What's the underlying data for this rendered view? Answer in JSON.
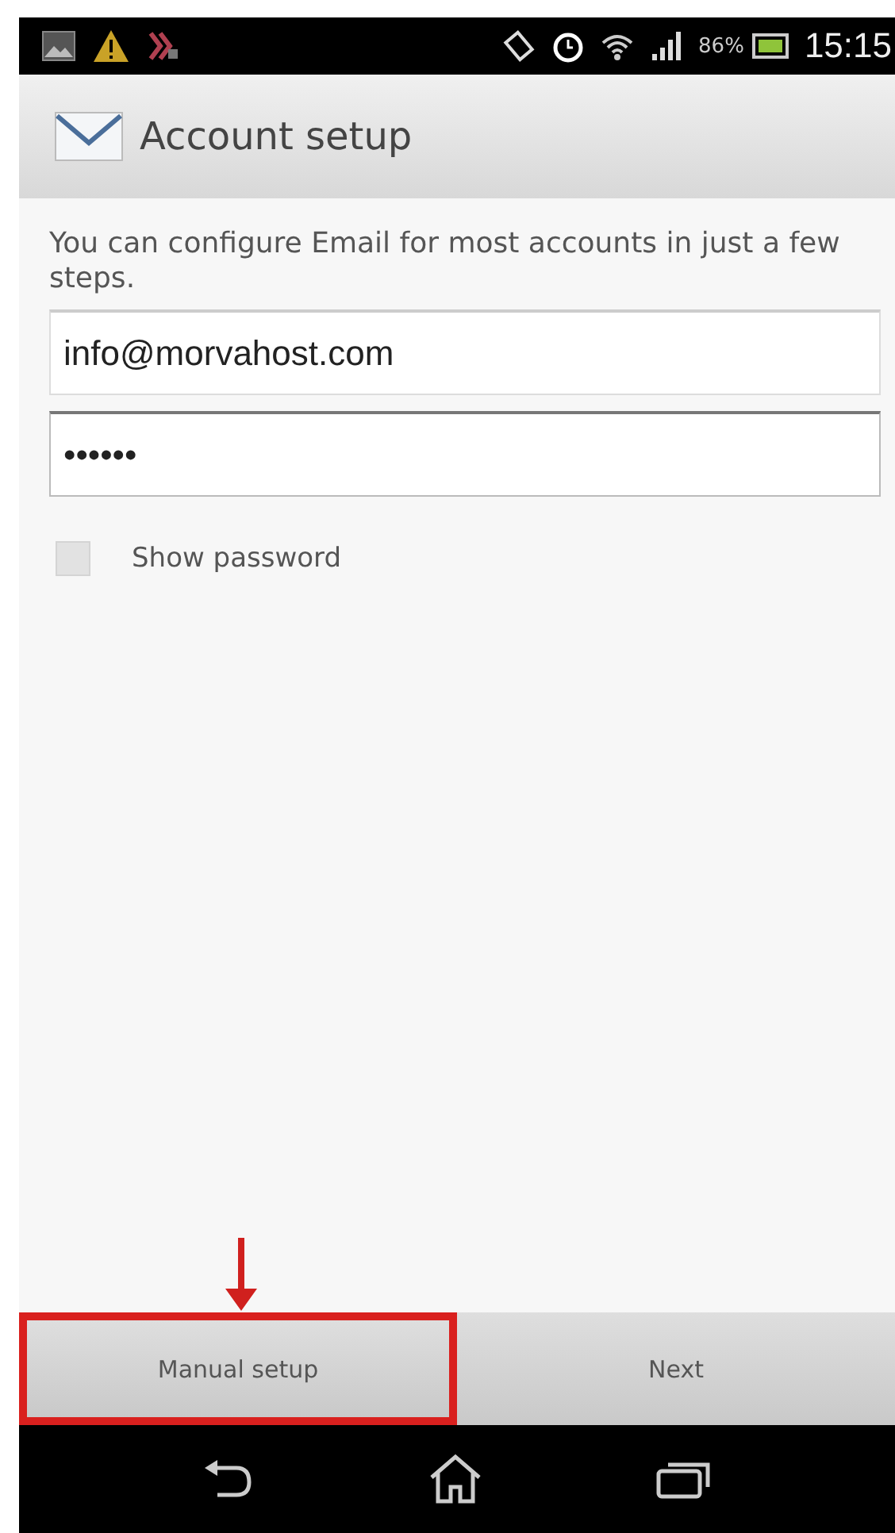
{
  "status_bar": {
    "battery_percent": "86%",
    "time": "15:15"
  },
  "action_bar": {
    "title": "Account setup"
  },
  "intro": "You can configure Email for most accounts in just a few steps.",
  "fields": [
    {
      "value": "info@morvahost.com",
      "focused": false
    },
    {
      "value": "••••••",
      "focused": true
    }
  ],
  "show_password": {
    "label": "Show password",
    "checked": false
  },
  "buttons": [
    {
      "label": "Manual setup",
      "highlighted": true
    },
    {
      "label": "Next",
      "highlighted": false
    }
  ]
}
